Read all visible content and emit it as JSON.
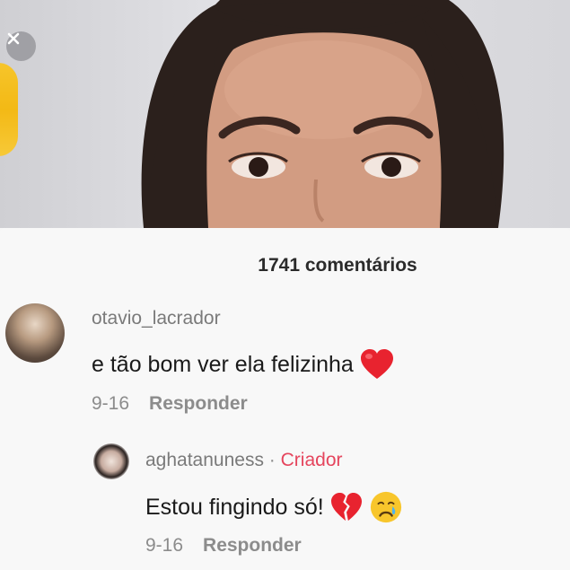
{
  "comments_header": {
    "count_label": "1741 comentários"
  },
  "comments": [
    {
      "username": "otavio_lacrador",
      "text": "e tão bom ver ela felizinha",
      "emoji": "heart-icon",
      "date": "9-16",
      "reply_label": "Responder"
    }
  ],
  "replies": [
    {
      "username": "aghatanuness",
      "separator": "·",
      "badge": "Criador",
      "text": "Estou fingindo só!",
      "emojis": [
        "broken-heart-icon",
        "crying-face-icon"
      ],
      "date": "9-16",
      "reply_label": "Responder"
    }
  ],
  "colors": {
    "creator_badge": "#e5455d",
    "heart": "#e8232f",
    "gift_coin": "#f3b915"
  }
}
